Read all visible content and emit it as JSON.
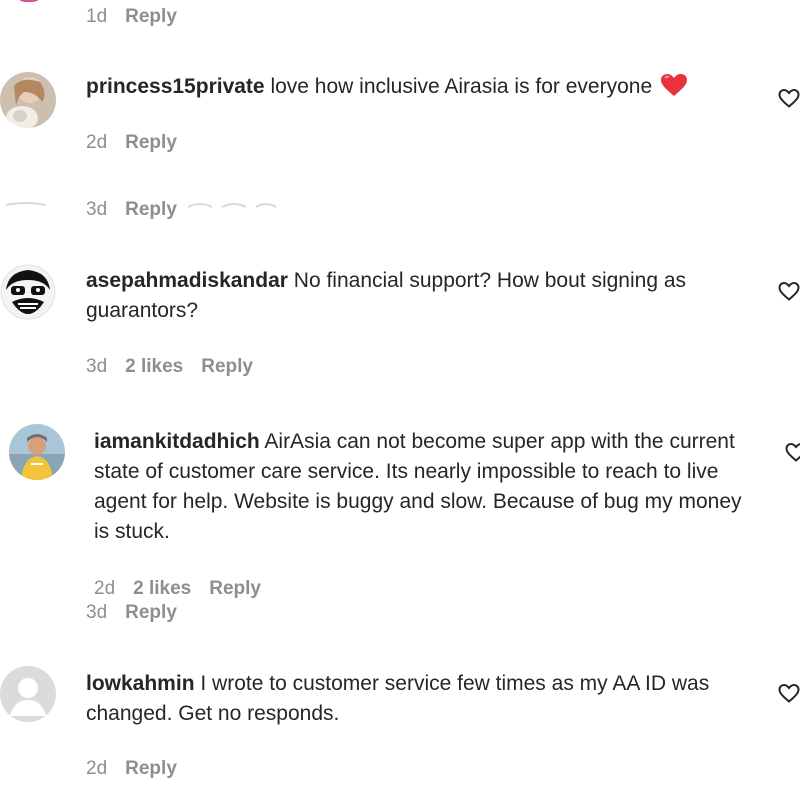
{
  "top": {
    "time": "1d",
    "reply": "Reply"
  },
  "comments": [
    {
      "username": "princess15private",
      "text": "love how inclusive Airasia is for everyone",
      "emoji": "❤️",
      "time": "2d",
      "likes": "",
      "reply": "Reply"
    },
    {
      "username": "",
      "text": "",
      "time": "3d",
      "likes": "",
      "reply": "Reply"
    },
    {
      "username": "asepahmadiskandar",
      "text": "No financial support? How bout signing as guarantors?",
      "time": "3d",
      "likes": "2 likes",
      "reply": "Reply"
    },
    {
      "username": "iamankitdadhich",
      "text": "AirAsia can not become super app with the current state of customer care service. Its nearly impossible to reach to live agent for help. Website is buggy and slow. Because of bug my money is stuck.",
      "time": "2d",
      "likes": "2 likes",
      "reply": "Reply"
    },
    {
      "username": "",
      "text": "",
      "time": "3d",
      "likes": "",
      "reply": "Reply"
    },
    {
      "username": "lowkahmin",
      "text": "I wrote to customer service few times as my AA ID was changed. Get no responds.",
      "time": "2d",
      "likes": "",
      "reply": "Reply"
    }
  ],
  "icons": {
    "like": "heart-outline-icon",
    "default_avatar": "default-avatar-icon"
  },
  "colors": {
    "text": "#262626",
    "muted": "#8e8e8e",
    "emoji_heart": "#e8333d"
  }
}
